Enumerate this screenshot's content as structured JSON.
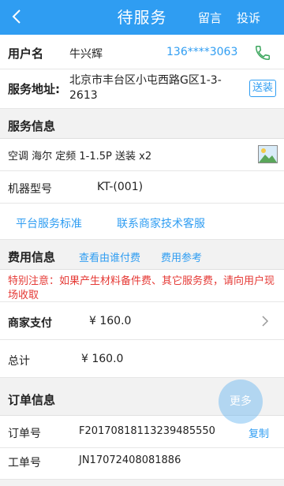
{
  "nav": {
    "title": "待服务",
    "action_message": "留言",
    "action_complaint": "投诉"
  },
  "user": {
    "label": "用户名",
    "name": "牛兴辉",
    "phone": "136****3063"
  },
  "address": {
    "label": "服务地址:",
    "value": "北京市丰台区小屯西路G区1-3-2613",
    "tag": "送装"
  },
  "service": {
    "title": "服务信息",
    "product": "空调 海尔 定频 1-1.5P 送装 x2",
    "model_label": "机器型号",
    "model_value": "KT-(001)",
    "link_standard": "平台服务标准",
    "link_support": "联系商家技术客服"
  },
  "fees": {
    "title": "费用信息",
    "link_payer": "查看由谁付费",
    "link_reference": "费用参考",
    "notice": "特别注意：如果产生材料备件费、其它服务费，请向用户现场收取",
    "merchant_label": "商家支付",
    "merchant_value": "¥ 160.0",
    "total_label": "总计",
    "total_value": "¥ 160.0"
  },
  "order": {
    "title": "订单信息",
    "order_no_label": "订单号",
    "order_no_value": "F20170818113239485550",
    "copy_label": "复制",
    "ticket_label": "工单号",
    "ticket_value": "JN17072408081886"
  },
  "fab": {
    "label": "更多"
  },
  "colors": {
    "accent": "#2f9df2",
    "warning": "#e53935",
    "phone_icon": "#3aa55c"
  }
}
